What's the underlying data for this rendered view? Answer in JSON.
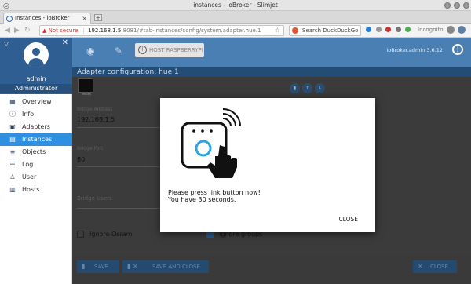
{
  "window": {
    "title": "instances - ioBroker - Slimjet"
  },
  "browser": {
    "tab_title": "Instances - ioBroker",
    "url_warning": "Not secure",
    "url_host": "192.168.1.5",
    "url_path": ":8081/#tab-instances/config/system.adapter.hue.1",
    "search_placeholder": "Search DuckDuckGo",
    "incognito_label": "Incognito"
  },
  "sidebar": {
    "username": "admin",
    "role": "Administrator",
    "items": [
      {
        "label": "Overview",
        "icon": "grid-icon"
      },
      {
        "label": "Info",
        "icon": "info-icon"
      },
      {
        "label": "Adapters",
        "icon": "store-icon"
      },
      {
        "label": "Instances",
        "icon": "instances-icon",
        "active": true
      },
      {
        "label": "Objects",
        "icon": "list-icon"
      },
      {
        "label": "Log",
        "icon": "log-icon"
      },
      {
        "label": "User",
        "icon": "user-icon"
      },
      {
        "label": "Hosts",
        "icon": "hosts-icon"
      }
    ]
  },
  "toolbar": {
    "host_button": "HOST RASPBERRYPI",
    "version": "ioBroker.admin 3.6.12"
  },
  "content": {
    "title": "Adapter configuration: hue.1",
    "adapter_thumb_text": "PHILIPS",
    "fields": [
      {
        "label": "Bridge Address",
        "value": "192.168.1.5"
      },
      {
        "label": "Bridge Port",
        "value": "80"
      },
      {
        "label": "Bridge Users",
        "value": ""
      }
    ],
    "checkbox_ignore_osram": "Ignore Osram",
    "checkbox_ignore_groups": "Ignore groups",
    "ignore_osram_checked": false,
    "ignore_groups_checked": true
  },
  "footer": {
    "save": "SAVE",
    "save_and_close": "SAVE AND CLOSE",
    "close": "CLOSE"
  },
  "modal": {
    "line1": "Please press link button now!",
    "line2": "You have 30 seconds.",
    "close": "CLOSE"
  },
  "colors": {
    "toolbar": "#4a7fb3",
    "sidebar_active": "#2f8fe0",
    "link_ring": "#29a6e0"
  }
}
